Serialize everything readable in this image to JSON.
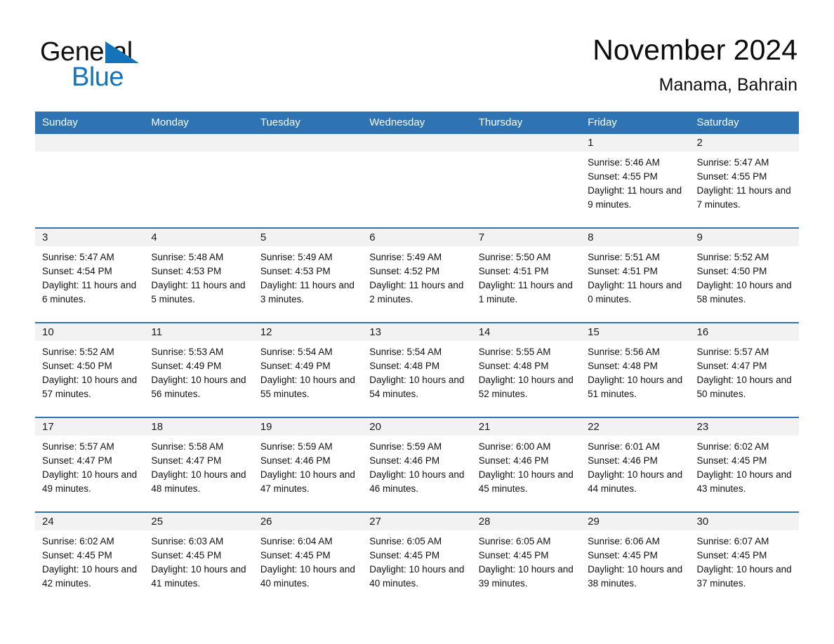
{
  "logo": {
    "word_general": "General",
    "word_blue": "Blue"
  },
  "header": {
    "title": "November 2024",
    "subtitle": "Manama, Bahrain"
  },
  "calendar": {
    "weekday_headers": [
      "Sunday",
      "Monday",
      "Tuesday",
      "Wednesday",
      "Thursday",
      "Friday",
      "Saturday"
    ],
    "colors": {
      "header_blue": "#2e74b5",
      "row_divider_blue": "#2e74b5",
      "daynum_band": "#f2f2f2",
      "logo_blue": "#1573ba",
      "text": "#111111"
    },
    "weeks": [
      [
        {
          "day": "",
          "sunrise": "",
          "sunset": "",
          "daylight": ""
        },
        {
          "day": "",
          "sunrise": "",
          "sunset": "",
          "daylight": ""
        },
        {
          "day": "",
          "sunrise": "",
          "sunset": "",
          "daylight": ""
        },
        {
          "day": "",
          "sunrise": "",
          "sunset": "",
          "daylight": ""
        },
        {
          "day": "",
          "sunrise": "",
          "sunset": "",
          "daylight": ""
        },
        {
          "day": "1",
          "sunrise": "Sunrise: 5:46 AM",
          "sunset": "Sunset: 4:55 PM",
          "daylight": "Daylight: 11 hours and 9 minutes."
        },
        {
          "day": "2",
          "sunrise": "Sunrise: 5:47 AM",
          "sunset": "Sunset: 4:55 PM",
          "daylight": "Daylight: 11 hours and 7 minutes."
        }
      ],
      [
        {
          "day": "3",
          "sunrise": "Sunrise: 5:47 AM",
          "sunset": "Sunset: 4:54 PM",
          "daylight": "Daylight: 11 hours and 6 minutes."
        },
        {
          "day": "4",
          "sunrise": "Sunrise: 5:48 AM",
          "sunset": "Sunset: 4:53 PM",
          "daylight": "Daylight: 11 hours and 5 minutes."
        },
        {
          "day": "5",
          "sunrise": "Sunrise: 5:49 AM",
          "sunset": "Sunset: 4:53 PM",
          "daylight": "Daylight: 11 hours and 3 minutes."
        },
        {
          "day": "6",
          "sunrise": "Sunrise: 5:49 AM",
          "sunset": "Sunset: 4:52 PM",
          "daylight": "Daylight: 11 hours and 2 minutes."
        },
        {
          "day": "7",
          "sunrise": "Sunrise: 5:50 AM",
          "sunset": "Sunset: 4:51 PM",
          "daylight": "Daylight: 11 hours and 1 minute."
        },
        {
          "day": "8",
          "sunrise": "Sunrise: 5:51 AM",
          "sunset": "Sunset: 4:51 PM",
          "daylight": "Daylight: 11 hours and 0 minutes."
        },
        {
          "day": "9",
          "sunrise": "Sunrise: 5:52 AM",
          "sunset": "Sunset: 4:50 PM",
          "daylight": "Daylight: 10 hours and 58 minutes."
        }
      ],
      [
        {
          "day": "10",
          "sunrise": "Sunrise: 5:52 AM",
          "sunset": "Sunset: 4:50 PM",
          "daylight": "Daylight: 10 hours and 57 minutes."
        },
        {
          "day": "11",
          "sunrise": "Sunrise: 5:53 AM",
          "sunset": "Sunset: 4:49 PM",
          "daylight": "Daylight: 10 hours and 56 minutes."
        },
        {
          "day": "12",
          "sunrise": "Sunrise: 5:54 AM",
          "sunset": "Sunset: 4:49 PM",
          "daylight": "Daylight: 10 hours and 55 minutes."
        },
        {
          "day": "13",
          "sunrise": "Sunrise: 5:54 AM",
          "sunset": "Sunset: 4:48 PM",
          "daylight": "Daylight: 10 hours and 54 minutes."
        },
        {
          "day": "14",
          "sunrise": "Sunrise: 5:55 AM",
          "sunset": "Sunset: 4:48 PM",
          "daylight": "Daylight: 10 hours and 52 minutes."
        },
        {
          "day": "15",
          "sunrise": "Sunrise: 5:56 AM",
          "sunset": "Sunset: 4:48 PM",
          "daylight": "Daylight: 10 hours and 51 minutes."
        },
        {
          "day": "16",
          "sunrise": "Sunrise: 5:57 AM",
          "sunset": "Sunset: 4:47 PM",
          "daylight": "Daylight: 10 hours and 50 minutes."
        }
      ],
      [
        {
          "day": "17",
          "sunrise": "Sunrise: 5:57 AM",
          "sunset": "Sunset: 4:47 PM",
          "daylight": "Daylight: 10 hours and 49 minutes."
        },
        {
          "day": "18",
          "sunrise": "Sunrise: 5:58 AM",
          "sunset": "Sunset: 4:47 PM",
          "daylight": "Daylight: 10 hours and 48 minutes."
        },
        {
          "day": "19",
          "sunrise": "Sunrise: 5:59 AM",
          "sunset": "Sunset: 4:46 PM",
          "daylight": "Daylight: 10 hours and 47 minutes."
        },
        {
          "day": "20",
          "sunrise": "Sunrise: 5:59 AM",
          "sunset": "Sunset: 4:46 PM",
          "daylight": "Daylight: 10 hours and 46 minutes."
        },
        {
          "day": "21",
          "sunrise": "Sunrise: 6:00 AM",
          "sunset": "Sunset: 4:46 PM",
          "daylight": "Daylight: 10 hours and 45 minutes."
        },
        {
          "day": "22",
          "sunrise": "Sunrise: 6:01 AM",
          "sunset": "Sunset: 4:46 PM",
          "daylight": "Daylight: 10 hours and 44 minutes."
        },
        {
          "day": "23",
          "sunrise": "Sunrise: 6:02 AM",
          "sunset": "Sunset: 4:45 PM",
          "daylight": "Daylight: 10 hours and 43 minutes."
        }
      ],
      [
        {
          "day": "24",
          "sunrise": "Sunrise: 6:02 AM",
          "sunset": "Sunset: 4:45 PM",
          "daylight": "Daylight: 10 hours and 42 minutes."
        },
        {
          "day": "25",
          "sunrise": "Sunrise: 6:03 AM",
          "sunset": "Sunset: 4:45 PM",
          "daylight": "Daylight: 10 hours and 41 minutes."
        },
        {
          "day": "26",
          "sunrise": "Sunrise: 6:04 AM",
          "sunset": "Sunset: 4:45 PM",
          "daylight": "Daylight: 10 hours and 40 minutes."
        },
        {
          "day": "27",
          "sunrise": "Sunrise: 6:05 AM",
          "sunset": "Sunset: 4:45 PM",
          "daylight": "Daylight: 10 hours and 40 minutes."
        },
        {
          "day": "28",
          "sunrise": "Sunrise: 6:05 AM",
          "sunset": "Sunset: 4:45 PM",
          "daylight": "Daylight: 10 hours and 39 minutes."
        },
        {
          "day": "29",
          "sunrise": "Sunrise: 6:06 AM",
          "sunset": "Sunset: 4:45 PM",
          "daylight": "Daylight: 10 hours and 38 minutes."
        },
        {
          "day": "30",
          "sunrise": "Sunrise: 6:07 AM",
          "sunset": "Sunset: 4:45 PM",
          "daylight": "Daylight: 10 hours and 37 minutes."
        }
      ]
    ]
  }
}
